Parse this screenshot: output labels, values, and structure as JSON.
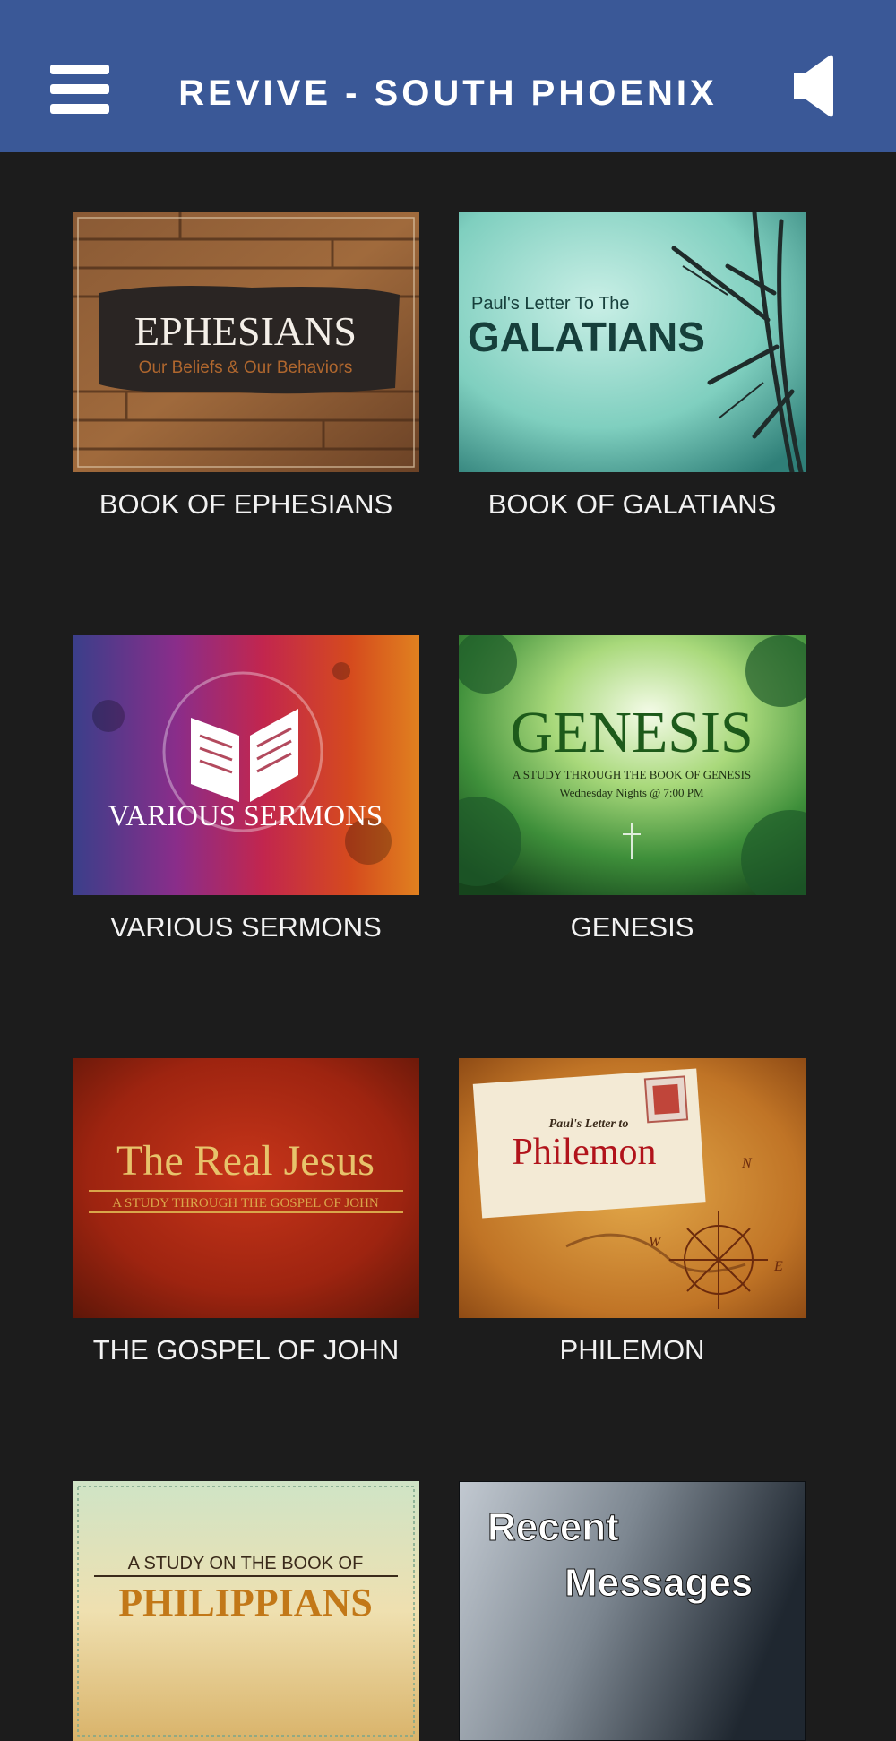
{
  "header": {
    "title": "REVIVE - SOUTH PHOENIX",
    "menu_icon": "hamburger-menu-icon",
    "sound_icon": "speaker-icon"
  },
  "colors": {
    "header_bg": "#3a5897",
    "page_bg": "#1c1c1c",
    "caption_text": "#f2f2f2"
  },
  "series": [
    {
      "caption": "BOOK OF EPHESIANS",
      "art": {
        "title": "EPHESIANS",
        "subtitle": "Our Beliefs & Our Behaviors"
      }
    },
    {
      "caption": "BOOK OF GALATIANS",
      "art": {
        "kicker": "Paul's Letter To The",
        "title": "GALATIANS"
      }
    },
    {
      "caption": "VARIOUS SERMONS",
      "art": {
        "title": "VARIOUS SERMONS"
      }
    },
    {
      "caption": "GENESIS",
      "art": {
        "title": "GENESIS",
        "subtitle": "A STUDY THROUGH THE BOOK OF GENESIS",
        "note": "Wednesday Nights @ 7:00 PM"
      }
    },
    {
      "caption": "THE GOSPEL OF JOHN",
      "art": {
        "title": "The Real Jesus",
        "subtitle": "A STUDY THROUGH THE GOSPEL OF JOHN"
      }
    },
    {
      "caption": "PHILEMON",
      "art": {
        "kicker": "Paul's Letter to",
        "title": "Philemon",
        "compass_n": "N",
        "compass_w": "W",
        "compass_e": "E"
      }
    },
    {
      "caption": "",
      "art": {
        "kicker": "A STUDY ON THE BOOK OF",
        "title": "PHILIPPIANS"
      }
    },
    {
      "caption": "",
      "art": {
        "line1": "Recent",
        "line2": "Messages"
      }
    }
  ]
}
